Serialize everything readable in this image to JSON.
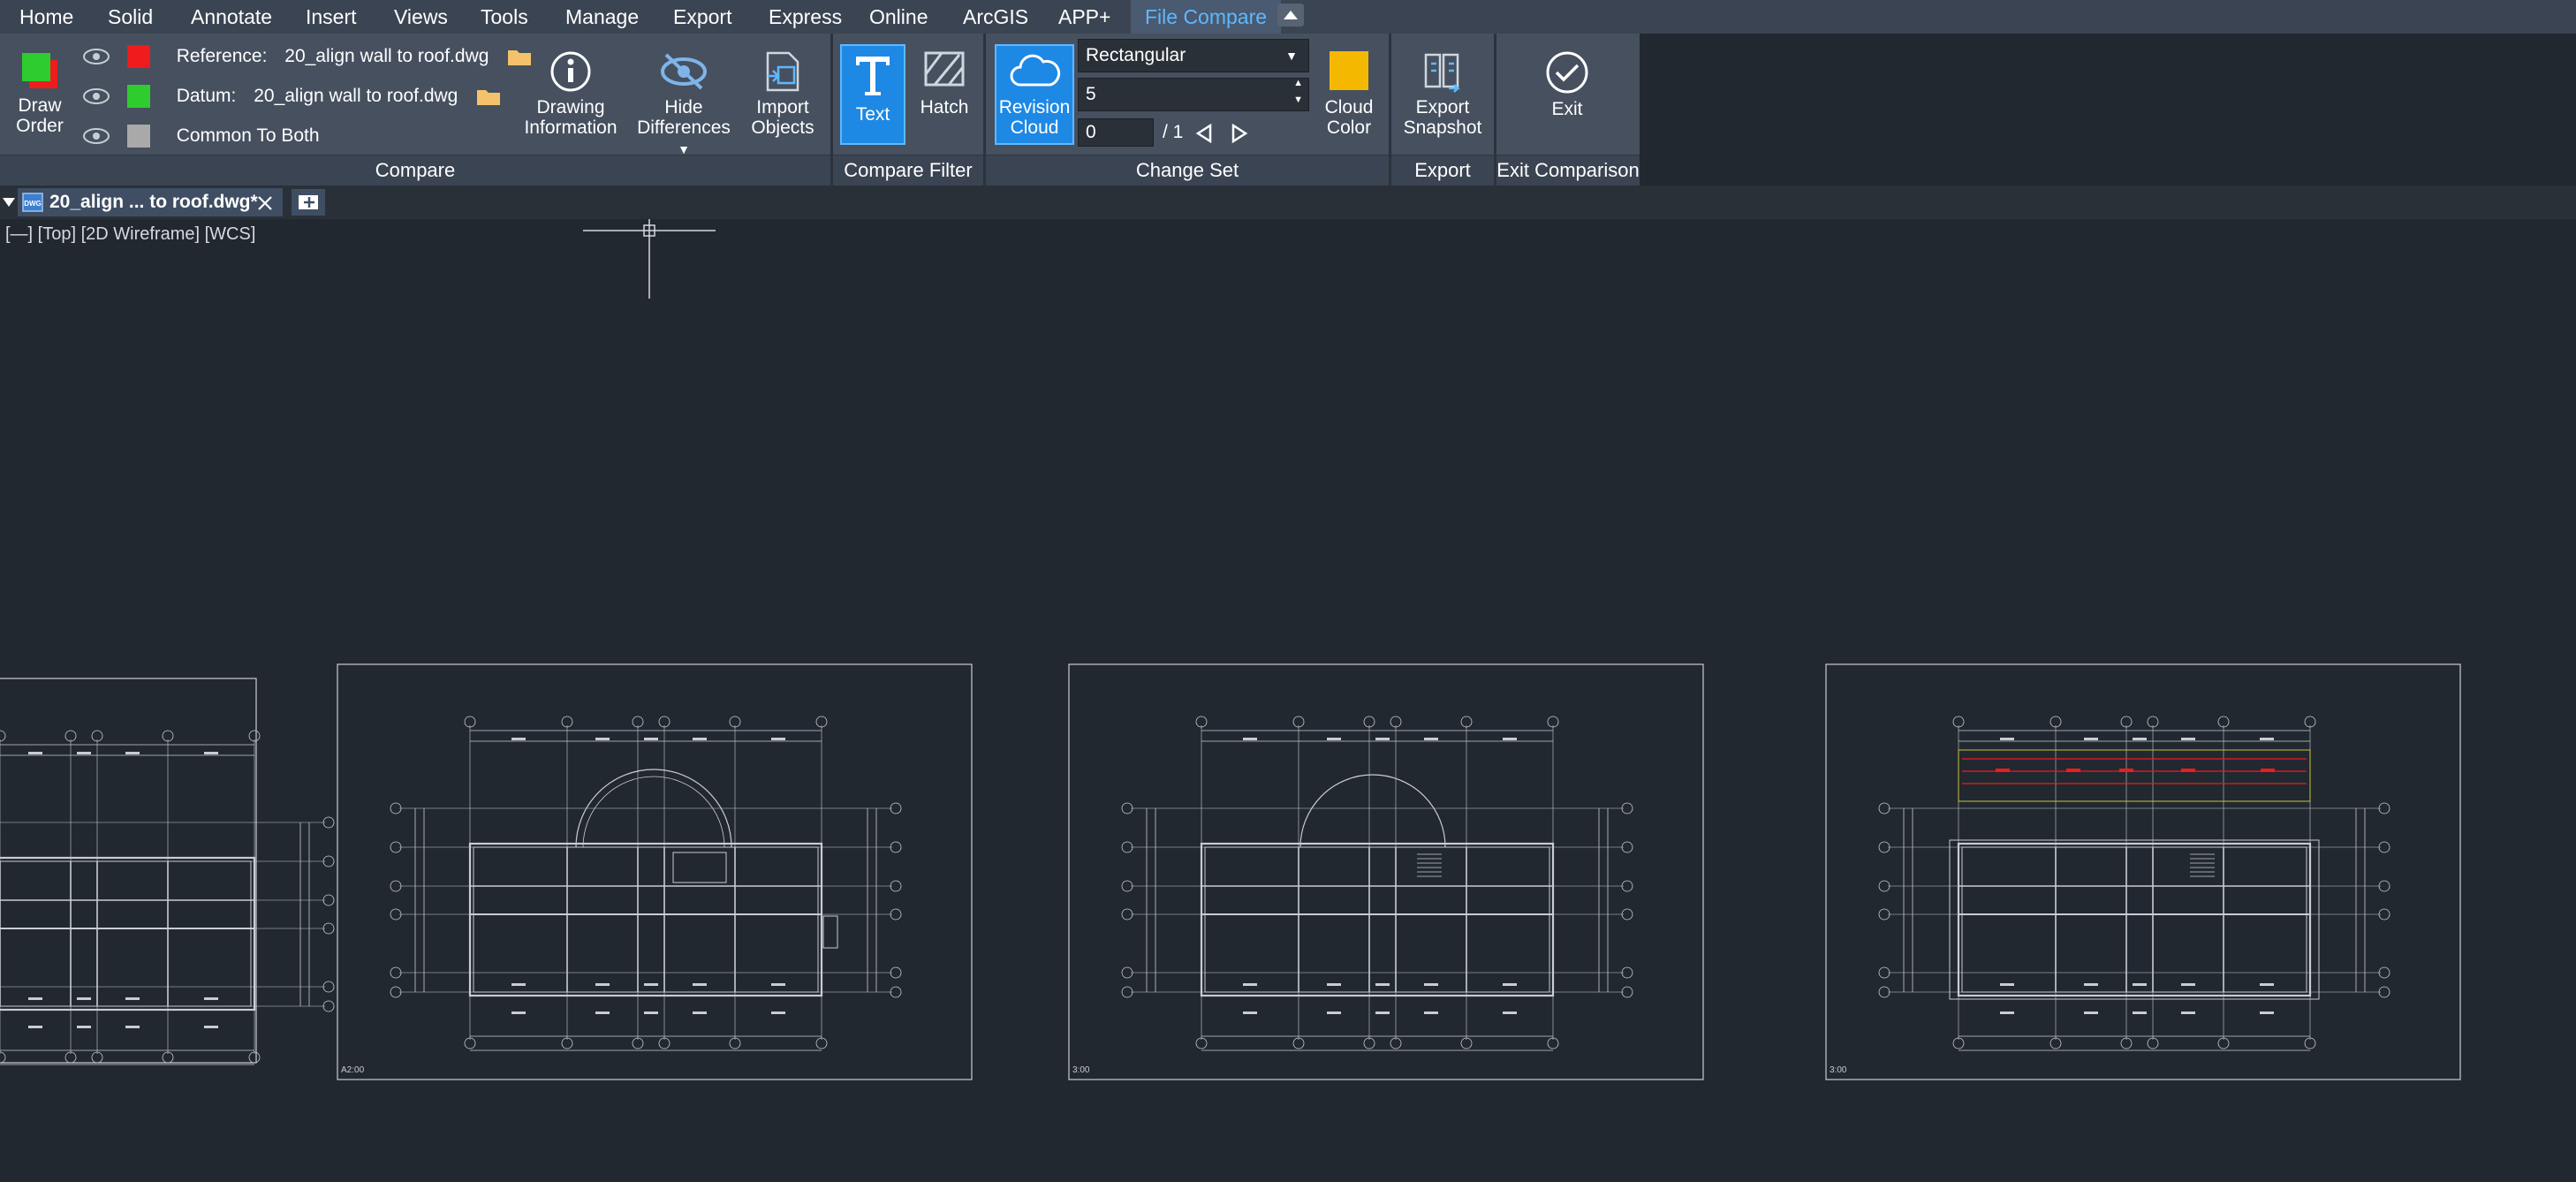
{
  "menu": [
    "Home",
    "Solid",
    "Annotate",
    "Insert",
    "Views",
    "Tools",
    "Manage",
    "Export",
    "Express",
    "Online",
    "ArcGIS",
    "APP+",
    "File Compare"
  ],
  "active_menu": "File Compare",
  "compare": {
    "draw_order_label": "Draw Order",
    "reference_label": "Reference:",
    "reference_file": "20_align wall to roof.dwg",
    "datum_label": "Datum:",
    "datum_file": "20_align wall to roof.dwg",
    "common_label": "Common To Both",
    "drawing_info_label": "Drawing Information",
    "hide_diff_label": "Hide Differences",
    "import_objects_label": "Import Objects",
    "group_label": "Compare",
    "reference_color": "#ee1c1c",
    "datum_color": "#2ecc2e",
    "common_color": "#a9a9a9"
  },
  "compare_filter": {
    "text_label": "Text",
    "hatch_label": "Hatch",
    "group_label": "Compare Filter"
  },
  "change_set": {
    "revision_cloud_label": "Revision Cloud",
    "shape_value": "Rectangular",
    "size_value": "5",
    "index_value": "0",
    "total_label": "/ 1",
    "cloud_color_label": "Cloud Color",
    "cloud_color": "#f5b800",
    "group_label": "Change Set"
  },
  "export": {
    "snapshot_label": "Export Snapshot",
    "group_label": "Export"
  },
  "exit": {
    "exit_label": "Exit",
    "group_label": "Exit Comparison"
  },
  "document_tab": {
    "title": "20_align ... to roof.dwg*"
  },
  "viewport_label": "[—] [Top] [2D Wireframe] [WCS]",
  "sheets": [
    {
      "label": ""
    },
    {
      "label": "A2:00"
    },
    {
      "label": "3:00"
    },
    {
      "label": "3:00"
    }
  ]
}
